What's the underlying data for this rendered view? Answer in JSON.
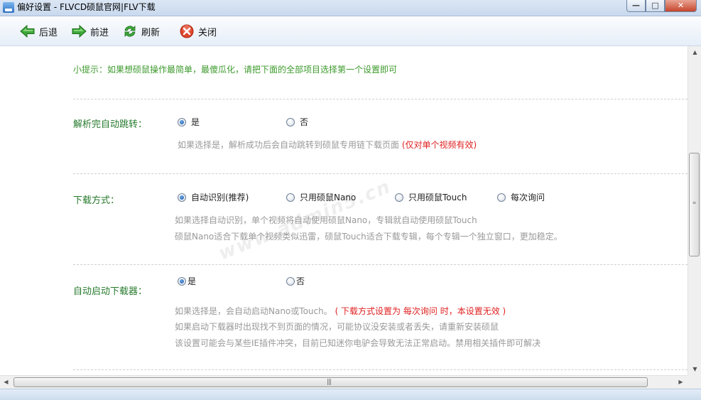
{
  "window": {
    "title": "偏好设置 - FLVCD硕鼠官网|FLV下载",
    "controls": {
      "minimize": "—",
      "maximize": "□",
      "close": "✕"
    }
  },
  "toolbar": {
    "back": "后退",
    "forward": "前进",
    "refresh": "刷新",
    "close": "关闭"
  },
  "hint": "小提示：如果想硕鼠操作最简单，最傻瓜化，请把下面的全部项目选择第一个设置即可",
  "watermark": "www.admin5.cn",
  "settings": {
    "auto_jump": {
      "label": "解析完自动跳转：",
      "options": [
        "是",
        "否"
      ],
      "selected": "是",
      "desc": "如果选择是，解析成功后会自动跳转到硕鼠专用链下载页面",
      "warn": "(仅对单个视频有效)"
    },
    "download_mode": {
      "label": "下载方式：",
      "options": [
        "自动识别(推荐)",
        "只用硕鼠Nano",
        "只用硕鼠Touch",
        "每次询问"
      ],
      "selected": "自动识别(推荐)",
      "desc_lines": [
        "如果选择自动识别，单个视频将自动使用硕鼠Nano，专辑就自动使用硕鼠Touch",
        "硕鼠Nano适合下载单个视频类似迅雷，硕鼠Touch适合下载专辑，每个专辑一个独立窗口，更加稳定。"
      ]
    },
    "auto_start": {
      "label": "自动启动下载器：",
      "options": [
        "是",
        "否"
      ],
      "selected": "是",
      "desc": "如果选择是，会自动启动Nano或Touch。",
      "warn": "( 下载方式设置为 每次询问 时，本设置无效 )",
      "desc_lines": [
        "如果启动下载器时出现找不到页面的情况，可能协议没安装或者丢失，请重新安装硕鼠",
        "该设置可能会与某些IE插件冲突，目前已知迷你电驴会导致无法正常启动。禁用相关插件即可解决"
      ]
    }
  },
  "colors": {
    "hint_green": "#3c9a2c",
    "label_green": "#267a2c",
    "desc_gray": "#999999",
    "warn_red": "#e02020"
  },
  "icons": {
    "back": "green-left-arrow-icon",
    "forward": "green-right-arrow-icon",
    "refresh": "green-refresh-icon",
    "close": "red-x-icon"
  }
}
